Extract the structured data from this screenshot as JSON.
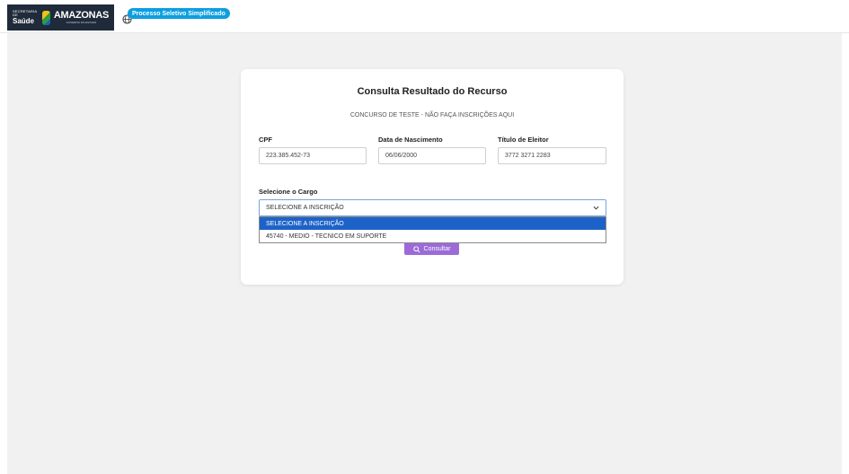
{
  "header": {
    "logo_small_line1": "SECRETARIA DE",
    "logo_small_line2": "Saúde",
    "logo_big_line1": "AMAZONAS",
    "logo_big_line2": "GOVERNO DO ESTADO",
    "pill_label": "Processo Seletivo Simplificado"
  },
  "form": {
    "title": "Consulta Resultado do Recurso",
    "subtitle": "CONCURSO DE TESTE - NÃO FAÇA INSCRIÇÕES AQUI",
    "cpf_label": "CPF",
    "cpf_value": "223.385.452-73",
    "birth_label": "Data de Nascimento",
    "birth_value": "06/06/2000",
    "voter_label": "Título de Eleitor",
    "voter_value": "3772 3271 2283",
    "cargo_label": "Selecione o Cargo",
    "cargo_selected": "SELECIONE A INSCRIÇÃO",
    "options": [
      "SELECIONE A INSCRIÇÃO",
      "45740 - MEDIO - TECNICO EM SUPORTE"
    ],
    "button_label": "Consultar"
  },
  "colors": {
    "pill": "#0d9ee0",
    "button": "#9c6bd8",
    "selected_option": "#1d62c8"
  }
}
